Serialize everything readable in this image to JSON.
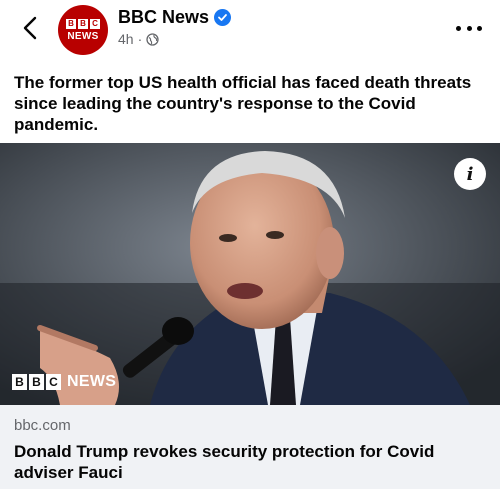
{
  "post": {
    "page_name": "BBC News",
    "time": "4h",
    "privacy_icon": "globe-icon",
    "avatar": {
      "letters": [
        "B",
        "B",
        "C"
      ],
      "word": "NEWS"
    },
    "caption": "The former top US health official has faced death threats since leading the country's response to the Covid pandemic."
  },
  "image": {
    "info_label": "i",
    "watermark": {
      "letters": [
        "B",
        "B",
        "C"
      ],
      "word": "NEWS"
    }
  },
  "link": {
    "domain": "bbc.com",
    "headline": "Donald Trump revokes security protection for Covid adviser Fauci"
  },
  "colors": {
    "brand": "#b80000",
    "verified": "#1877f2",
    "link_bg": "#f0f2f5",
    "meta_text": "#65676b"
  }
}
